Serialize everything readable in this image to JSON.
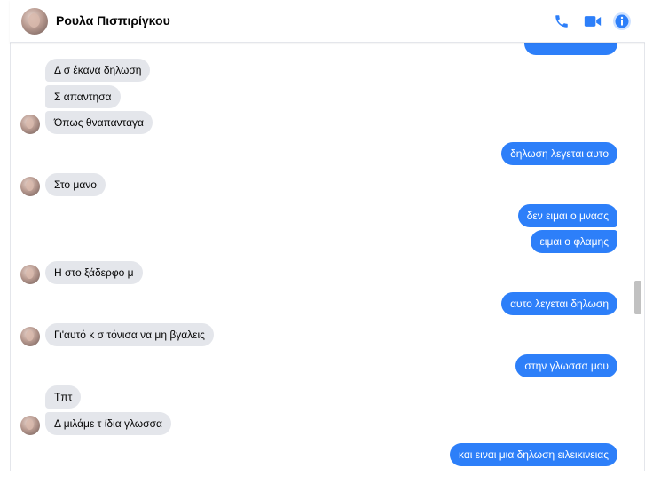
{
  "header": {
    "contact_name": "Ρουλα Πισπιρίγκου",
    "icons": [
      "phone-icon",
      "video-camera-icon",
      "info-icon"
    ],
    "accent_color": "#2d7ff9"
  },
  "messages": [
    {
      "side": "out",
      "text": "",
      "partial": true
    },
    {
      "side": "in",
      "text": "Δ σ έκανα δηλωση"
    },
    {
      "side": "in",
      "text": "Σ απαντησα"
    },
    {
      "side": "in",
      "text": "Όπως θναπανταγα"
    },
    {
      "side": "out",
      "text": "δηλωση λεγεται αυτο"
    },
    {
      "side": "in",
      "text": "Στο μανο"
    },
    {
      "side": "out",
      "text": "δεν ειμαι ο μνασς"
    },
    {
      "side": "out",
      "text": "ειμαι ο φλαμης"
    },
    {
      "side": "in",
      "text": "Η στο ξάδερφο μ"
    },
    {
      "side": "out",
      "text": "αυτο λεγεται δηλωση"
    },
    {
      "side": "in",
      "text": "Γι'αυτό κ σ τόνισα να μη βγαλεις"
    },
    {
      "side": "out",
      "text": "στην γλωσσα μου"
    },
    {
      "side": "in",
      "text": "Τπτ"
    },
    {
      "side": "in",
      "text": "Δ μιλάμε τ ίδια γλωσσα"
    },
    {
      "side": "out",
      "text": "και ειναι μια δηλωση ειλεικινειας"
    }
  ]
}
